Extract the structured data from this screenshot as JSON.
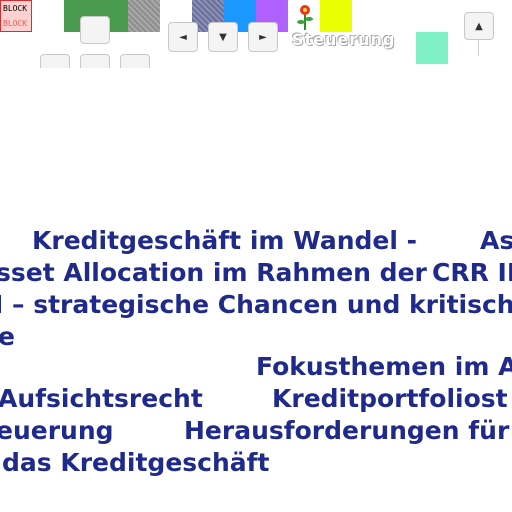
{
  "toolbar": {
    "block_label_top": "BLOCK",
    "block_label_bottom": "BLOCK",
    "swatches": [
      {
        "name": "green",
        "color": "#4a9a50"
      },
      {
        "name": "gray-texture",
        "color": "#9a9a9a"
      },
      {
        "name": "blue-pattern",
        "color": "#7a7fa8"
      },
      {
        "name": "blue",
        "color": "#1a98ff"
      },
      {
        "name": "purple",
        "color": "#b060ff"
      },
      {
        "name": "yellow",
        "color": "#eaff00"
      },
      {
        "name": "mint",
        "color": "#7ff0c8"
      }
    ],
    "steuerung_label": "Steuerung",
    "arrow_left": "◄",
    "arrow_down": "▼",
    "arrow_right": "►",
    "arrow_up": "▲"
  },
  "content": {
    "lines": [
      "Kreditgeschäft im Wandel -",
      "As",
      "sset Allocation im Rahmen der",
      "CRR II",
      "I – strategische Chancen und kritisch",
      "e",
      "Fokusthemen im A",
      "Aufsichtsrecht",
      "Kreditportfoliost",
      "euerung",
      "Herausforderungen für",
      "das Kreditgeschäft"
    ]
  }
}
